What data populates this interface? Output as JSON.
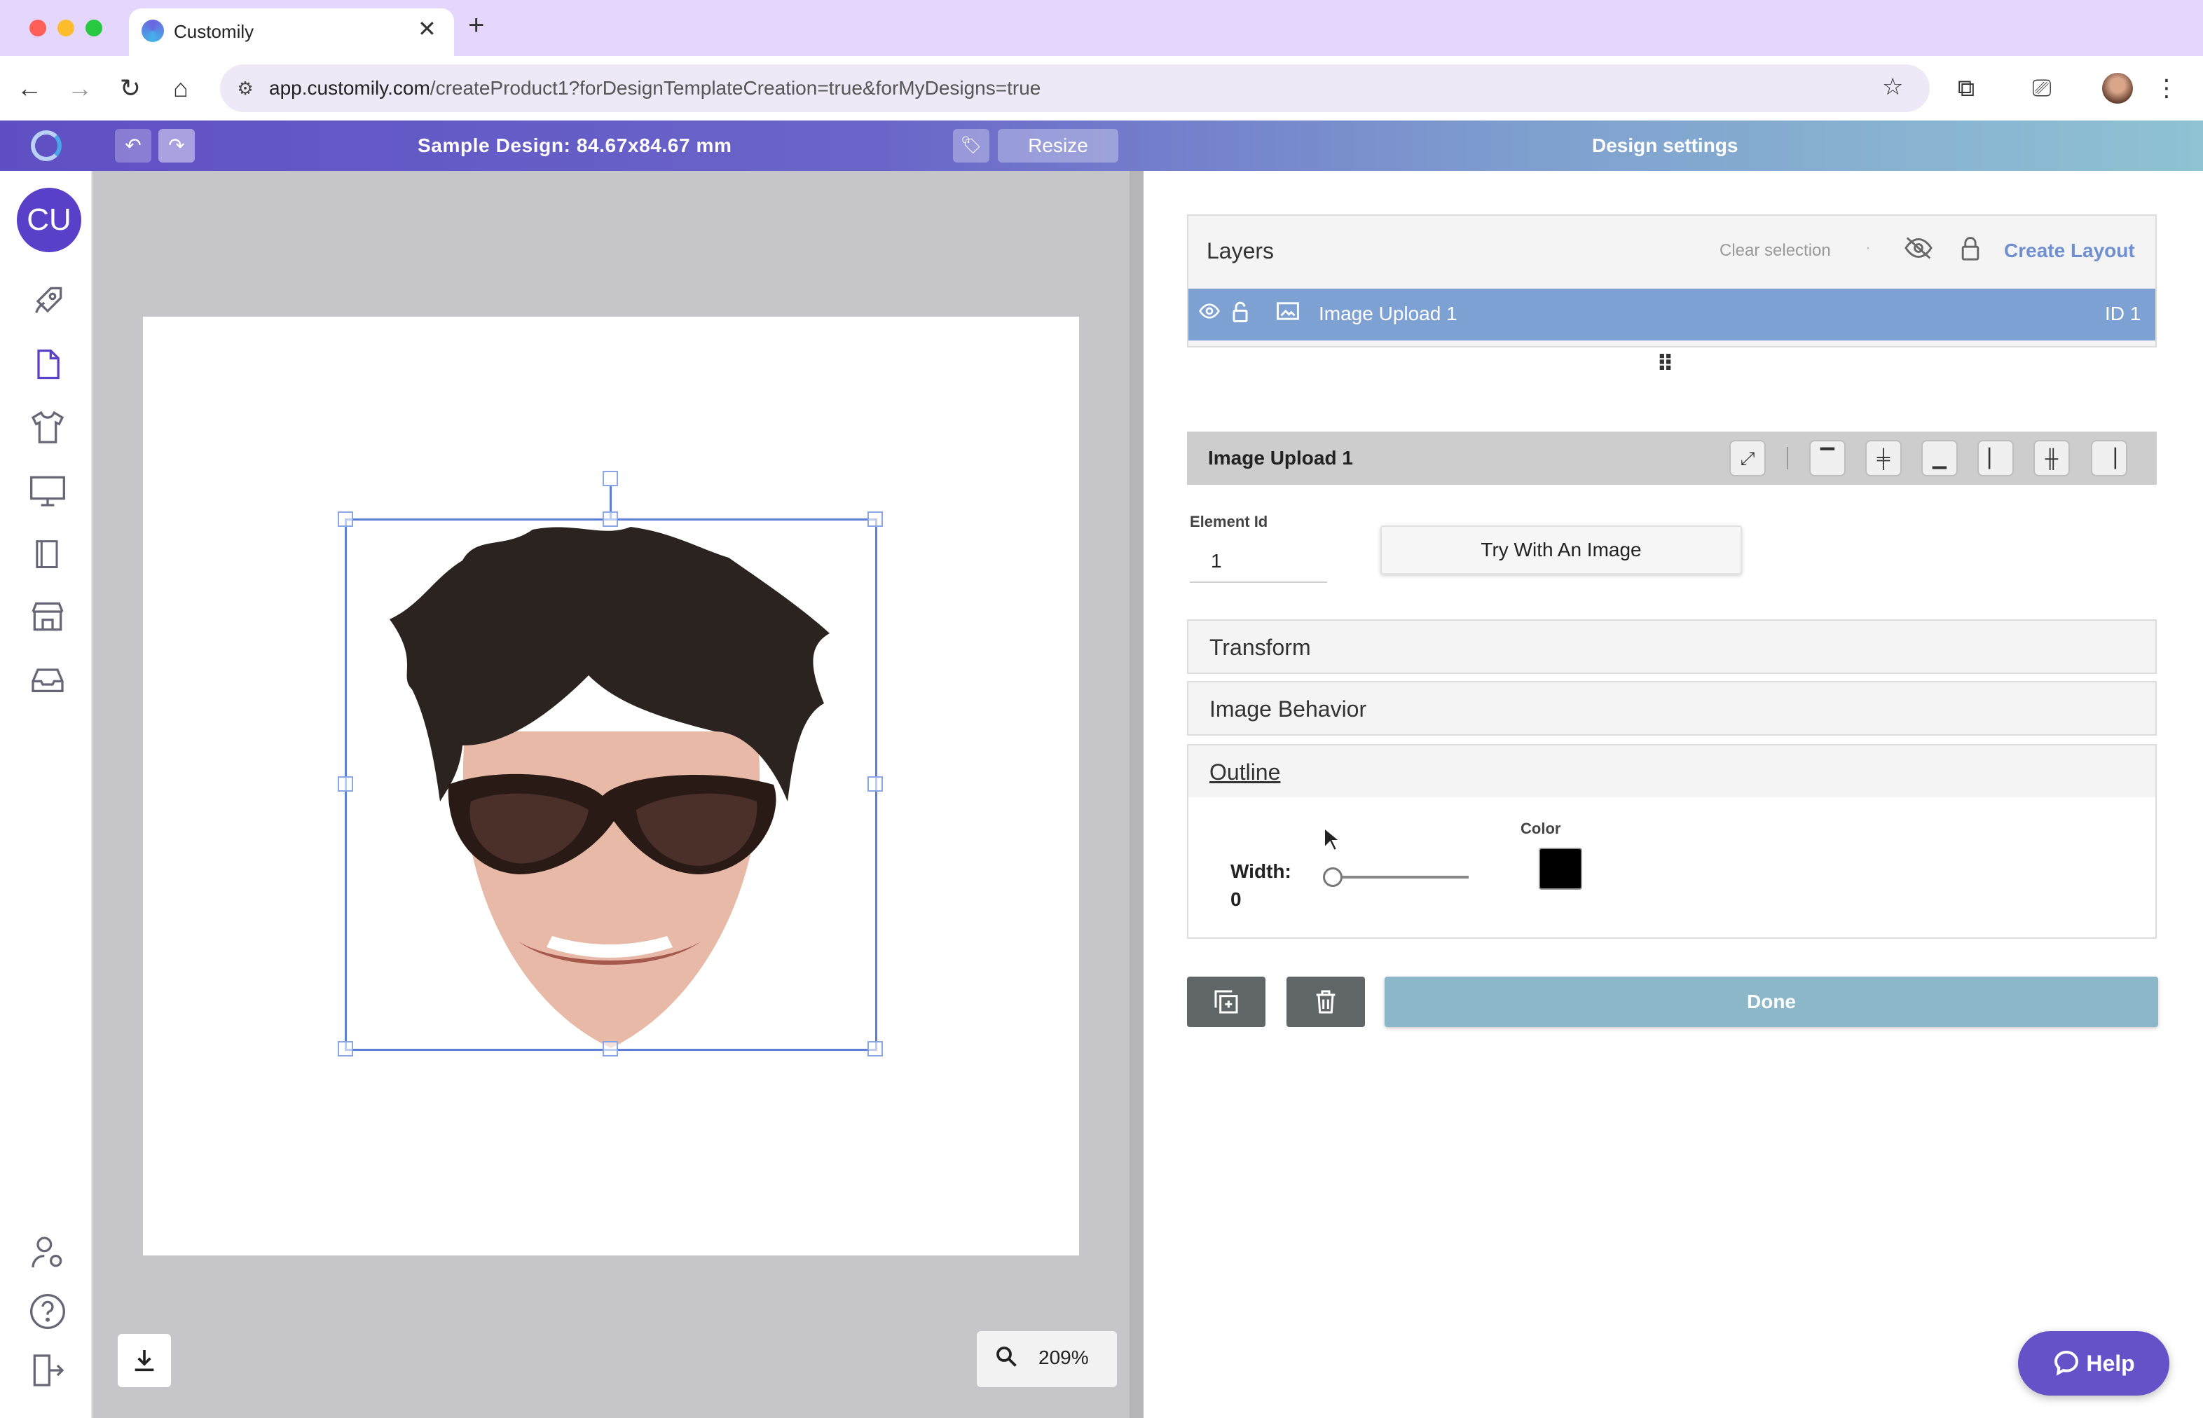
{
  "browser": {
    "tab_title": "Customily",
    "url_host": "app.customily.com",
    "url_path": "/createProduct1?forDesignTemplateCreation=true&forMyDesigns=true"
  },
  "header": {
    "design_title": "Sample Design: 84.67x84.67 mm",
    "resize_label": "Resize",
    "settings_title": "Design settings"
  },
  "sidebar": {
    "avatar_initials": "CU",
    "items": [
      {
        "name": "rocket-icon",
        "glyph": "🚀"
      },
      {
        "name": "document-icon",
        "glyph": "🗋"
      },
      {
        "name": "tshirt-icon",
        "glyph": "👕"
      },
      {
        "name": "monitor-icon",
        "glyph": "🖵"
      },
      {
        "name": "book-icon",
        "glyph": "📔"
      },
      {
        "name": "store-icon",
        "glyph": "🏪"
      },
      {
        "name": "inbox-icon",
        "glyph": "📥"
      }
    ],
    "bottom_items": [
      {
        "name": "user-settings-icon",
        "glyph": "👤"
      },
      {
        "name": "help-circle-icon",
        "glyph": "?"
      },
      {
        "name": "logout-icon",
        "glyph": "⇥"
      }
    ]
  },
  "canvas": {
    "zoom_level": "209%"
  },
  "layers": {
    "title": "Layers",
    "clear_selection": "Clear selection",
    "create_layout": "Create Layout",
    "rows": [
      {
        "name": "Image Upload 1",
        "id_label": "ID 1"
      }
    ]
  },
  "element": {
    "title": "Image Upload 1",
    "element_id_label": "Element Id",
    "element_id_value": "1",
    "try_button": "Try With An Image",
    "sections": {
      "transform": "Transform",
      "image_behavior": "Image Behavior",
      "outline": "Outline"
    },
    "outline": {
      "width_label": "Width:",
      "width_value": "0",
      "width_fraction": 0,
      "color_label": "Color",
      "color": "#000000"
    }
  },
  "actions": {
    "done_label": "Done"
  },
  "help": {
    "label": "Help"
  },
  "colors": {
    "brand": "#5a3fc8",
    "layer_selected": "#7ea1d4",
    "done": "#8bb7c9",
    "help": "#6552c9"
  }
}
